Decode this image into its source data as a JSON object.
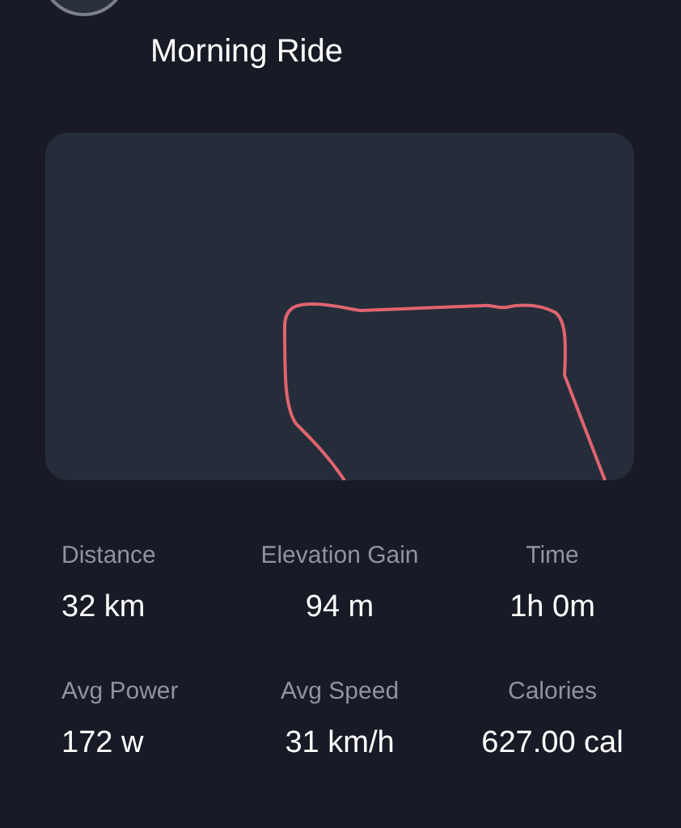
{
  "activity": {
    "title": "Morning Ride"
  },
  "stats": [
    {
      "label": "Distance",
      "value": "32 km"
    },
    {
      "label": "Elevation Gain",
      "value": "94 m"
    },
    {
      "label": "Time",
      "value": "1h 0m"
    },
    {
      "label": "Avg Power",
      "value": "172 w"
    },
    {
      "label": "Avg Speed",
      "value": "31 km/h"
    },
    {
      "label": "Calories",
      "value": "627.00 cal"
    }
  ]
}
